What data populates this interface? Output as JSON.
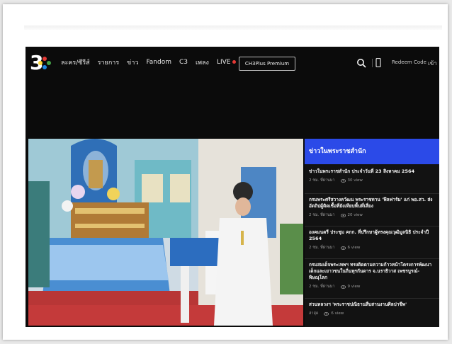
{
  "header": {
    "logo_text": "3",
    "nav": [
      {
        "label": "ละคร/ซีรีส์"
      },
      {
        "label": "รายการ"
      },
      {
        "label": "ข่าว"
      },
      {
        "label": "Fandom"
      },
      {
        "label": "C3"
      },
      {
        "label": "เพลง"
      },
      {
        "label": "LIVE"
      }
    ],
    "premium_label": "CH3Plus Premium",
    "redeem_label": "Redeem Code",
    "lang_label": "เข้า"
  },
  "sidebar": {
    "heading": "ข่าวในพระราชสำนัก",
    "items": [
      {
        "title": "ข่าวในพระราชสำนัก ประจำวันที่ 23 สิงหาคม 2564",
        "time": "2 ชม. ที่ผ่านมา",
        "views": "30 view"
      },
      {
        "title": "กรมพระศรีสวางควัฒน พระราชทาน 'ฟีลฟาร์ม' แก่ พอ.สว. ส่ง อัตถิปผู้ติดเชื้อที่ยังเทียบพื้นที่เสี่ยง",
        "time": "2 ชม. ที่ผ่านมา",
        "views": "20 view"
      },
      {
        "title": "องคมนตรี ประชุม คกก. ที่ปรึกษาผู้ทรงคุณวุฒิมูลนิธิ ประจำปี 2564",
        "time": "2 ชม. ที่ผ่านมา",
        "views": "6 view"
      },
      {
        "title": "กรมสมเด็จพระเทพฯ ทรงติดตามความก้าวหน้าโครงการพัฒนา เด็กและเยาวชนในถิ่นทุรกันดาร จ.นราธิวาส เพชรบูรณ์-พิษณุโลก",
        "time": "2 ชม. ที่ผ่านมา",
        "views": "9 view"
      },
      {
        "title": "สวนหลวงฯ 'พระราชปณิธานสืบสานงานศิลปาชีพ'",
        "time": "ล่าสุด",
        "views": "6 view"
      }
    ]
  },
  "colors": {
    "accent": "#2b4ae8",
    "live": "#e53935",
    "background": "#0b0b0b"
  }
}
